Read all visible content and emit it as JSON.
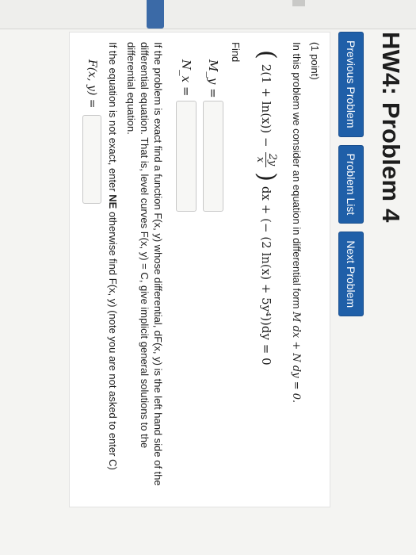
{
  "page": {
    "title": "HW4: Problem 4"
  },
  "nav": {
    "prev": "Previous Problem",
    "list": "Problem List",
    "next": "Next Problem"
  },
  "problem": {
    "points": "(1 point)",
    "intro": "In this problem we consider an equation in differential form",
    "intro_math": "M dx + N dy = 0.",
    "eq_part1": "2(1 + ln(x)) −",
    "eq_frac_num": "2y",
    "eq_frac_den": "x",
    "eq_part2": "dx + (− (2 ln(x) + 5y⁴))dy = 0",
    "find_label": "Find",
    "My_label": "M_y =",
    "Nx_label": "N_x =",
    "exact_text": "If the problem is exact find a function F(x, y) whose differential, dF(x, y) is the left hand side of the differential equation. That is, level curves F(x, y) = C, give implicit general solutions to the differential equation.",
    "notexact_pre": "If the equation is not exact, enter",
    "notexact_bold": "NE",
    "notexact_post": "otherwise find F(x, y) (note you are not asked to enter C)",
    "F_label": "F(x, y) ="
  },
  "inputs": {
    "My_value": "",
    "Nx_value": "",
    "F_value": ""
  },
  "colors": {
    "button": "#1f5fa8",
    "page": "#f4f4f2",
    "panel": "#ffffff"
  }
}
